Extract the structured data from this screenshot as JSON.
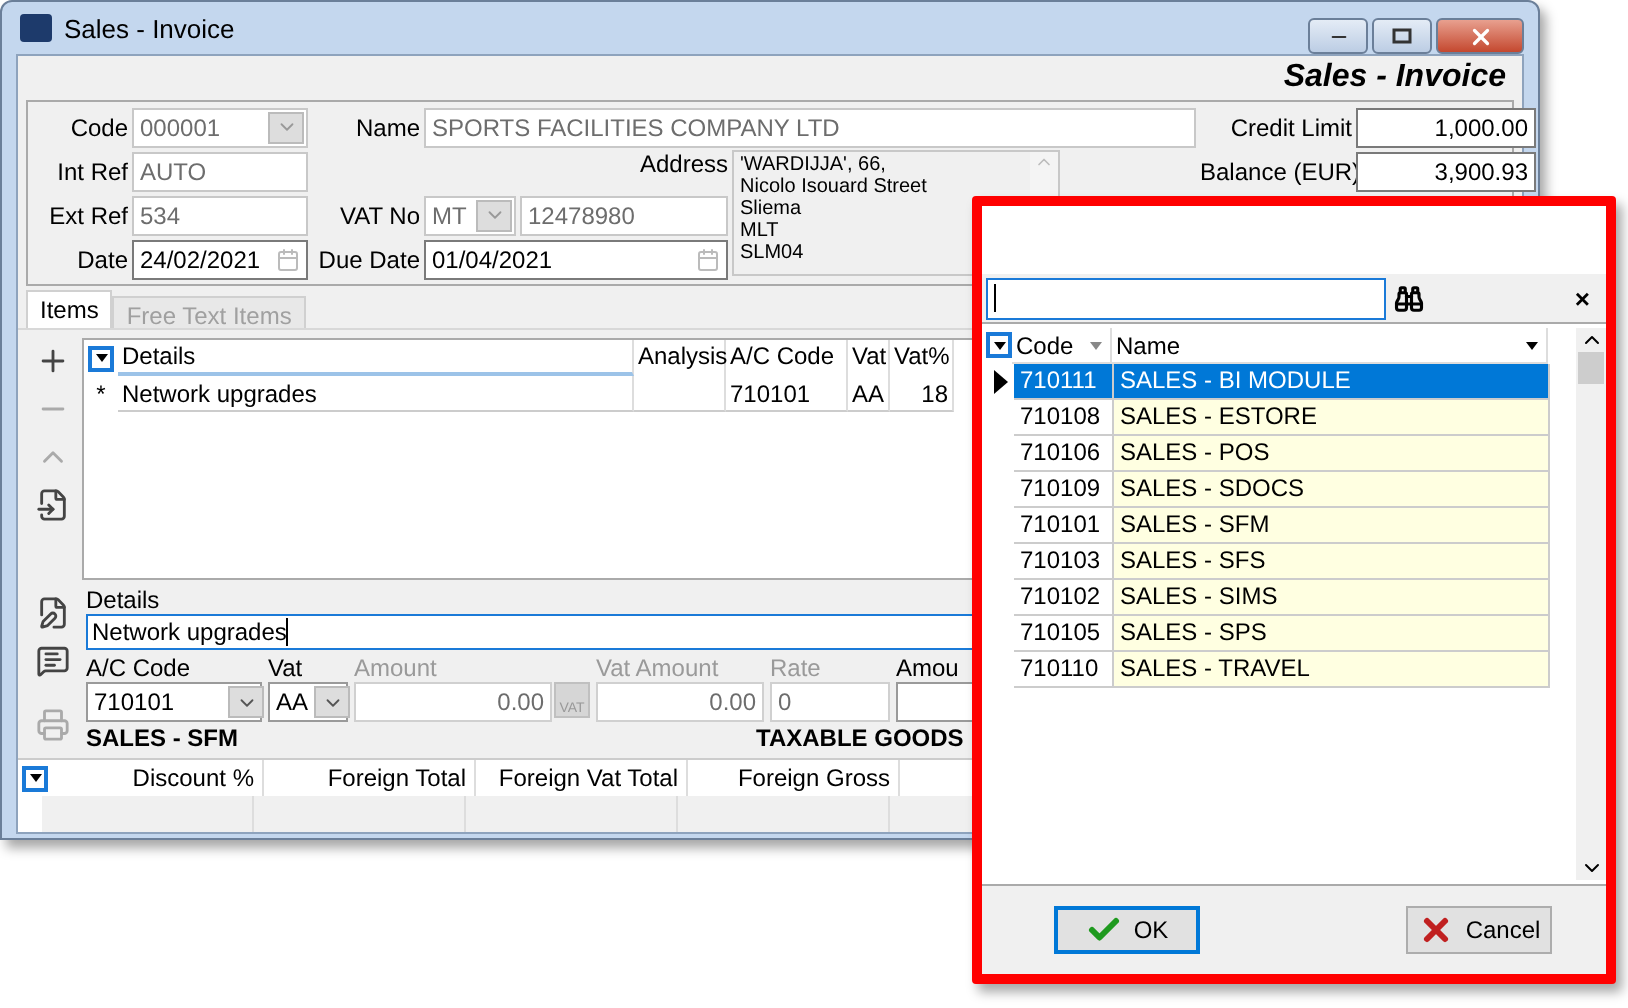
{
  "window": {
    "title": "Sales - Invoice",
    "heading": "Sales - Invoice"
  },
  "header_fields": {
    "code": {
      "label": "Code",
      "value": "000001"
    },
    "int_ref": {
      "label": "Int Ref",
      "value": "AUTO"
    },
    "ext_ref": {
      "label": "Ext Ref",
      "value": "534"
    },
    "date": {
      "label": "Date",
      "value": "24/02/2021"
    },
    "name": {
      "label": "Name",
      "value": "SPORTS FACILITIES COMPANY LTD"
    },
    "address": {
      "label": "Address",
      "lines": [
        "'WARDIJJA', 66,",
        "Nicolo Isouard Street",
        "Sliema",
        "MLT",
        "SLM04"
      ]
    },
    "vat_no": {
      "label": "VAT No",
      "prefix": "MT",
      "value": "12478980"
    },
    "due_date": {
      "label": "Due Date",
      "value": "01/04/2021"
    },
    "credit_limit": {
      "label": "Credit Limit",
      "value": "1,000.00"
    },
    "balance": {
      "label": "Balance (EUR)",
      "value": "3,900.93"
    }
  },
  "tabs": [
    {
      "label": "Items",
      "selected": true,
      "disabled": false
    },
    {
      "label": "Free Text Items",
      "selected": false,
      "disabled": true
    }
  ],
  "toolbar": [
    {
      "kind": "add",
      "disabled": false
    },
    {
      "kind": "remove",
      "disabled": true
    },
    {
      "kind": "move_up",
      "disabled": true
    },
    {
      "kind": "import",
      "disabled": false
    },
    {
      "kind": "edit",
      "disabled": false
    },
    {
      "kind": "note",
      "disabled": false
    },
    {
      "kind": "print",
      "disabled": true
    }
  ],
  "items_table": {
    "columns": [
      "Details",
      "Analysis",
      "A/C Code",
      "Vat",
      "Vat%"
    ],
    "rows": [
      {
        "marker": "*",
        "details": "Network upgrades",
        "ac_code": "710101",
        "vat": "AA",
        "vat_pct": "18"
      }
    ]
  },
  "line_editor": {
    "details": {
      "label": "Details",
      "value": "Network upgrades"
    },
    "fields": [
      {
        "kind": "combo",
        "label": "A/C Code",
        "value": "710101",
        "disabled": false
      },
      {
        "kind": "combo",
        "label": "Vat",
        "value": "AA",
        "disabled": false
      },
      {
        "kind": "amount",
        "label": "Amount",
        "value": "0.00",
        "button": "VAT",
        "disabled": true
      },
      {
        "kind": "amount",
        "label": "Vat Amount",
        "value": "0.00",
        "disabled": true
      },
      {
        "kind": "text",
        "label": "Rate",
        "value": "0",
        "disabled": true
      },
      {
        "kind": "text",
        "label": "Amou",
        "disabled": false
      }
    ],
    "account_name": "SALES - SFM",
    "tax_name": "TAXABLE GOODS"
  },
  "totals_table": {
    "columns": [
      "Discount %",
      "Foreign Total",
      "Foreign Vat Total",
      "Foreign Gross"
    ]
  },
  "lookup": {
    "columns": [
      "Code",
      "Name"
    ],
    "rows": [
      {
        "code": "710111",
        "name": "SALES - BI MODULE",
        "selected": true
      },
      {
        "code": "710108",
        "name": "SALES - ESTORE",
        "selected": false
      },
      {
        "code": "710106",
        "name": "SALES - POS",
        "selected": false
      },
      {
        "code": "710109",
        "name": "SALES - SDOCS",
        "selected": false
      },
      {
        "code": "710101",
        "name": "SALES - SFM",
        "selected": false
      },
      {
        "code": "710103",
        "name": "SALES - SFS",
        "selected": false
      },
      {
        "code": "710102",
        "name": "SALES - SIMS",
        "selected": false
      },
      {
        "code": "710105",
        "name": "SALES - SPS",
        "selected": false
      },
      {
        "code": "710110",
        "name": "SALES - TRAVEL",
        "selected": false
      }
    ],
    "close": "×",
    "buttons": [
      {
        "kind": "ok",
        "label": "OK",
        "default": true
      },
      {
        "kind": "cancel",
        "label": "Cancel",
        "default": false
      }
    ]
  }
}
